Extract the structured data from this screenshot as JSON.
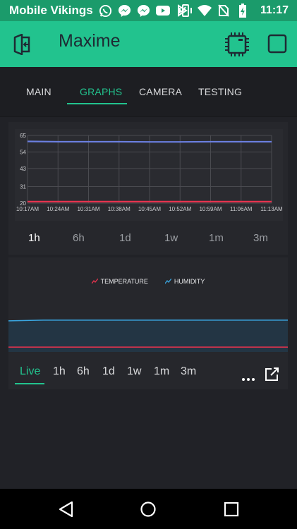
{
  "status_bar": {
    "carrier": "Mobile Vikings",
    "time": "11:17",
    "icons": [
      "whatsapp-icon",
      "messenger-icon",
      "messenger-icon",
      "youtube-icon",
      "check-icon",
      "vibrate-icon",
      "wifi-icon",
      "no-sim-icon",
      "battery-charging-icon"
    ]
  },
  "app_bar": {
    "title": "Maxime",
    "color": "#22c38e"
  },
  "tabs": [
    {
      "label": "MAIN"
    },
    {
      "label": "GRAPHS"
    },
    {
      "label": "CAMERA"
    },
    {
      "label": "TESTING"
    }
  ],
  "active_tab": "GRAPHS",
  "graph1": {
    "time_ranges": [
      "1h",
      "6h",
      "1d",
      "1w",
      "1m",
      "3m"
    ],
    "selected_range": "1h",
    "chart_data": {
      "type": "line",
      "x": [
        "10:17AM",
        "10:24AM",
        "10:31AM",
        "10:38AM",
        "10:45AM",
        "10:52AM",
        "10:59AM",
        "11:06AM",
        "11:13AM"
      ],
      "yticks": [
        20,
        31,
        43,
        54,
        65
      ],
      "ylim": [
        20,
        65
      ],
      "grid": true,
      "series": [
        {
          "color": "#6b7fe0",
          "values": [
            61,
            60.8,
            60.8,
            60.8,
            60.7,
            60.7,
            60.8,
            60.8,
            60.8
          ]
        },
        {
          "color": "#e8334e",
          "values": [
            21,
            21,
            21,
            21,
            21,
            21,
            21,
            21,
            21
          ]
        }
      ]
    }
  },
  "graph2": {
    "legend": [
      {
        "label": "TEMPERATURE",
        "color": "#e8334e"
      },
      {
        "label": "HUMIDITY",
        "color": "#3aa7e2"
      }
    ],
    "time_ranges": [
      "Live",
      "1h",
      "6h",
      "1d",
      "1w",
      "1m",
      "3m"
    ],
    "selected_range": "Live",
    "chart_data": {
      "type": "area",
      "series": [
        {
          "name": "HUMIDITY",
          "color": "#3aa7e2",
          "values": [
            60,
            61,
            61,
            61,
            61,
            61,
            61,
            61,
            61
          ]
        },
        {
          "name": "TEMPERATURE",
          "color": "#e8334e",
          "values": [
            21,
            21,
            21,
            21,
            21,
            21,
            21,
            21,
            21
          ]
        }
      ]
    }
  }
}
